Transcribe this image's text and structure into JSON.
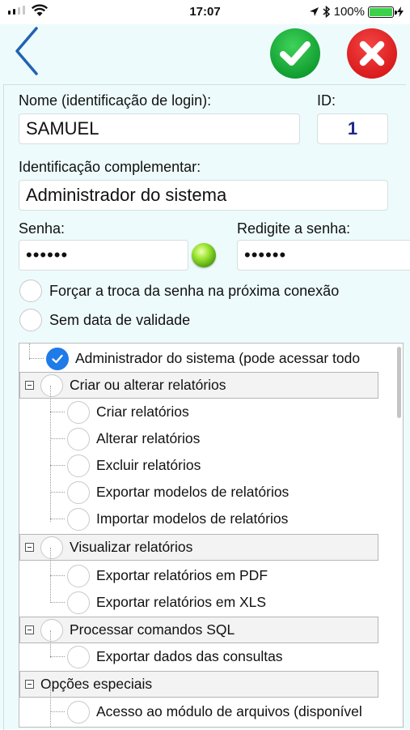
{
  "status": {
    "time": "17:07",
    "battery": "100%"
  },
  "colors": {
    "confirm": "#1aae3a",
    "cancel": "#e32426",
    "back": "#1f63b3",
    "panel": "#eefbfc",
    "check": "#1e7be8",
    "led": "#7fd32a"
  },
  "toolbar": {
    "back_icon": "chevron-left-icon",
    "confirm_icon": "checkmark-icon",
    "cancel_icon": "close-x-icon"
  },
  "form": {
    "name_label": "Nome (identificação de login):",
    "name_value": "SAMUEL",
    "id_label": "ID:",
    "id_value": "1",
    "extra_label": "Identificação complementar:",
    "extra_value": "Administrador do sistema",
    "password_label": "Senha:",
    "password_value": "••••••",
    "password_confirm_label": "Redigite a senha:",
    "password_confirm_value": "••••••",
    "force_change_label": "Forçar a troca da senha na próxima conexão",
    "no_expiry_label": "Sem data de validade"
  },
  "permissions": [
    {
      "label": "Administrador do sistema (pode acessar todo",
      "level": 0,
      "type": "item",
      "checked": true
    },
    {
      "label": "Criar ou alterar relatórios",
      "level": 0,
      "type": "group",
      "checked": false
    },
    {
      "label": "Criar relatórios",
      "level": 1,
      "type": "item",
      "checked": false
    },
    {
      "label": "Alterar relatórios",
      "level": 1,
      "type": "item",
      "checked": false
    },
    {
      "label": "Excluir relatórios",
      "level": 1,
      "type": "item",
      "checked": false
    },
    {
      "label": "Exportar modelos de relatórios",
      "level": 1,
      "type": "item",
      "checked": false
    },
    {
      "label": "Importar modelos de relatórios",
      "level": 1,
      "type": "item",
      "checked": false
    },
    {
      "label": "Visualizar relatórios",
      "level": 0,
      "type": "group",
      "checked": false
    },
    {
      "label": "Exportar relatórios em PDF",
      "level": 1,
      "type": "item",
      "checked": false
    },
    {
      "label": "Exportar relatórios em XLS",
      "level": 1,
      "type": "item",
      "checked": false
    },
    {
      "label": "Processar comandos SQL",
      "level": 0,
      "type": "group",
      "checked": false
    },
    {
      "label": "Exportar dados das consultas",
      "level": 1,
      "type": "item",
      "checked": false
    },
    {
      "label": "Opções especiais",
      "level": 0,
      "type": "group-nocheck",
      "checked": false
    },
    {
      "label": "Acesso ao módulo de arquivos (disponível",
      "level": 1,
      "type": "item",
      "checked": false
    }
  ]
}
